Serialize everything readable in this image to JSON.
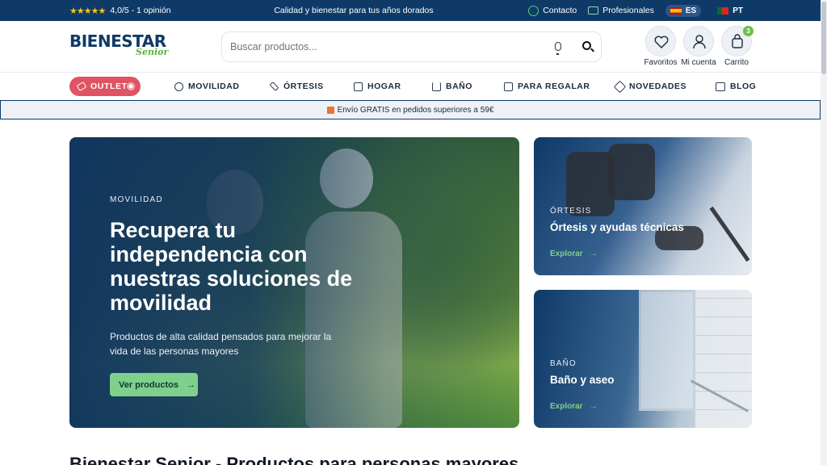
{
  "topbar": {
    "stars": "★★★★★",
    "rating_text": "4,0/5 - 1 opinión",
    "promo": "Calidad y bienestar para tus años dorados",
    "contact": "Contacto",
    "professionals": "Profesionales",
    "lang_es": "ES",
    "lang_pt": "PT"
  },
  "header": {
    "logo_main": "BIENESTAR",
    "logo_sub": "Senior",
    "search_placeholder": "Buscar productos...",
    "favorites_label": "Favoritos",
    "account_label": "Mi cuenta",
    "cart_label": "Carrito",
    "cart_count": "3"
  },
  "nav": {
    "outlet": "OUTLET",
    "items": [
      {
        "label": "MOVILIDAD",
        "icon": "mobility-icon"
      },
      {
        "label": "ÓRTESIS",
        "icon": "bandage-icon"
      },
      {
        "label": "HOGAR",
        "icon": "home-icon"
      },
      {
        "label": "BAÑO",
        "icon": "bathtub-icon"
      },
      {
        "label": "PARA REGALAR",
        "icon": "gift-icon"
      },
      {
        "label": "NOVEDADES",
        "icon": "sparkle-icon"
      },
      {
        "label": "BLOG",
        "icon": "book-icon"
      }
    ]
  },
  "shipping": {
    "text": "Envío GRATIS en pedidos superiores a 59€"
  },
  "hero": {
    "kicker": "MOVILIDAD",
    "title": "Recupera tu independencia con nuestras soluciones de movilidad",
    "description": "Productos de alta calidad pensados para mejorar la vida de las personas mayores",
    "button": "Ver productos"
  },
  "cards": [
    {
      "kicker": "ÓRTESIS",
      "title": "Órtesis y ayudas técnicas",
      "link": "Explorar"
    },
    {
      "kicker": "BAÑO",
      "title": "Baño y aseo",
      "link": "Explorar"
    }
  ],
  "section": {
    "title": "Bienestar Senior - Productos para personas mayores"
  },
  "colors": {
    "navy": "#0f3a68",
    "green": "#7fd08c",
    "outlet": "#e05363"
  }
}
